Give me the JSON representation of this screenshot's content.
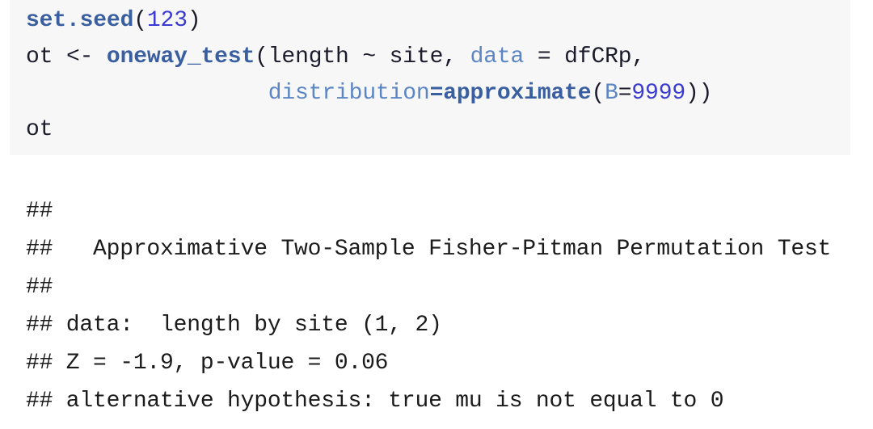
{
  "document": {
    "kind": "r-markdown-rendered-code-chunk",
    "background_color": "#ffffff"
  },
  "code_chunk": {
    "background_color": "#f7f7f7",
    "lines": [
      {
        "id": "line-1",
        "text": "set.seed(123)",
        "tokens": [
          {
            "text": "set.seed",
            "type": "fn"
          },
          {
            "text": "(",
            "type": "plain"
          },
          {
            "text": "123",
            "type": "num"
          },
          {
            "text": ")",
            "type": "plain"
          }
        ]
      },
      {
        "id": "line-2",
        "text": "ot <- oneway_test(length ~ site, data = dfCRp,",
        "tokens": [
          {
            "text": "ot <- ",
            "type": "plain"
          },
          {
            "text": "oneway_test",
            "type": "fn"
          },
          {
            "text": "(length ~ site, ",
            "type": "plain"
          },
          {
            "text": "data",
            "type": "arg"
          },
          {
            "text": " = dfCRp,",
            "type": "plain"
          }
        ]
      },
      {
        "id": "line-3",
        "text": "                  distribution=approximate(B=9999))",
        "tokens": [
          {
            "text": "                  ",
            "type": "plain"
          },
          {
            "text": "distribution",
            "type": "arg"
          },
          {
            "text": "=approximate",
            "type": "fn"
          },
          {
            "text": "(",
            "type": "plain"
          },
          {
            "text": "B",
            "type": "arg"
          },
          {
            "text": "=",
            "type": "plain"
          },
          {
            "text": "9999",
            "type": "num"
          },
          {
            "text": "))",
            "type": "plain"
          }
        ]
      },
      {
        "id": "line-4",
        "text": "ot",
        "tokens": [
          {
            "text": "ot",
            "type": "plain"
          }
        ]
      }
    ],
    "syntax_colors": {
      "function": "#3a5fa0",
      "argument": "#5c85c4",
      "number": "#3a3ad0",
      "plain": "#1b1b2b"
    }
  },
  "console_output": {
    "prefix": "##",
    "text_color": "#1b1b1b",
    "lines": [
      "## ",
      "##   Approximative Two-Sample Fisher-Pitman Permutation Test",
      "## ",
      "## data:  length by site (1, 2)",
      "## Z = -1.9, p-value = 0.06",
      "## alternative hypothesis: true mu is not equal to 0"
    ]
  },
  "results": {
    "test_name": "Approximative Two-Sample Fisher-Pitman Permutation Test",
    "data_description": "length by site (1, 2)",
    "Z": "-1.9",
    "p_value": "0.06",
    "alternative_hypothesis": "true mu is not equal to 0",
    "seed": "123",
    "B": "9999"
  }
}
